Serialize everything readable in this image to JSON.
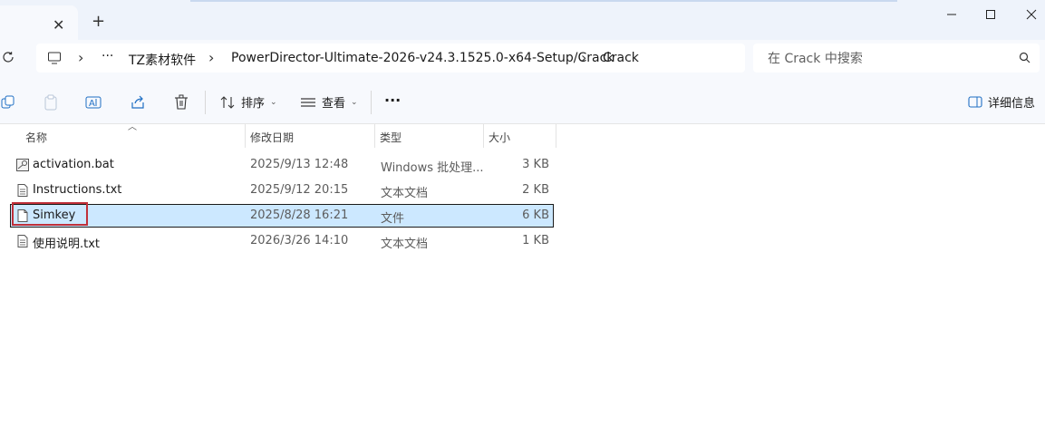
{
  "breadcrumb": {
    "ellipsis": "···",
    "items": [
      "TZ素材软件",
      "PowerDirector-Ultimate-2026-v24.3.1525.0-x64-Setup/Crack",
      "Crack"
    ]
  },
  "search": {
    "placeholder": "在 Crack 中搜索"
  },
  "toolbar": {
    "sort_label": "排序",
    "view_label": "查看",
    "more_label": "···",
    "details_label": "详细信息"
  },
  "columns": {
    "name": "名称",
    "modified": "修改日期",
    "type": "类型",
    "size": "大小"
  },
  "files": [
    {
      "name": "activation.bat",
      "modified": "2025/9/13 12:48",
      "type": "Windows 批处理...",
      "size": "3 KB",
      "icon": "batch-file-icon"
    },
    {
      "name": "Instructions.txt",
      "modified": "2025/9/12 20:15",
      "type": "文本文档",
      "size": "2 KB",
      "icon": "text-file-icon"
    },
    {
      "name": "Simkey",
      "modified": "2025/8/28 16:21",
      "type": "文件",
      "size": "6 KB",
      "icon": "file-icon",
      "selected": true
    },
    {
      "name": "使用说明.txt",
      "modified": "2026/3/26 14:10",
      "type": "文本文档",
      "size": "1 KB",
      "icon": "text-file-icon"
    }
  ],
  "colors": {
    "selection": "#cce8ff",
    "highlight": "#c0303a",
    "chrome": "#eef3fb"
  }
}
